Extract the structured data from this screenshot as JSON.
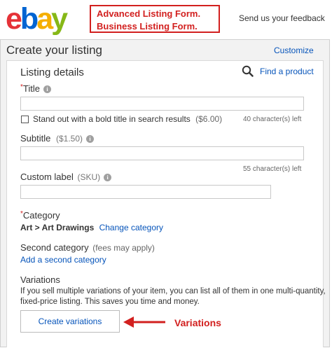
{
  "header": {
    "logo_letters": [
      {
        "char": "e",
        "color": "#e53238"
      },
      {
        "char": "b",
        "color": "#0064d2"
      },
      {
        "char": "a",
        "color": "#f5af02"
      },
      {
        "char": "y",
        "color": "#86b817"
      }
    ],
    "annotation_line1": "Advanced Listing Form.",
    "annotation_line2": "Business Listing Form.",
    "feedback_link": "Send us your feedback"
  },
  "page": {
    "title": "Create your listing",
    "customize_link": "Customize"
  },
  "listing_details": {
    "heading": "Listing details",
    "find_product_link": "Find a product",
    "title_field": {
      "required_mark": "*",
      "label": "Title",
      "value": "",
      "bold_option_label": "Stand out with a bold title in search results",
      "bold_option_price": "($6.00)",
      "chars_left": "40 character(s) left"
    },
    "subtitle_field": {
      "label": "Subtitle",
      "price": "($1.50)",
      "value": "",
      "chars_left": "55 character(s) left"
    },
    "custom_label_field": {
      "label": "Custom label",
      "suffix": "(SKU)",
      "value": ""
    },
    "category": {
      "required_mark": "*",
      "label": "Category",
      "value": "Art > Art Drawings",
      "change_link": "Change category"
    },
    "second_category": {
      "label": "Second category",
      "note": "(fees may apply)",
      "add_link": "Add a second category"
    },
    "variations": {
      "heading": "Variations",
      "description_line1": "If you sell multiple variations of your item, you can list all of them in one multi-quantity,",
      "description_line2": "fixed-price listing. This saves you time and money.",
      "create_button": "Create variations",
      "callout": "Variations"
    }
  },
  "colors": {
    "link": "#0654ba",
    "annotation_red": "#d2201f"
  }
}
